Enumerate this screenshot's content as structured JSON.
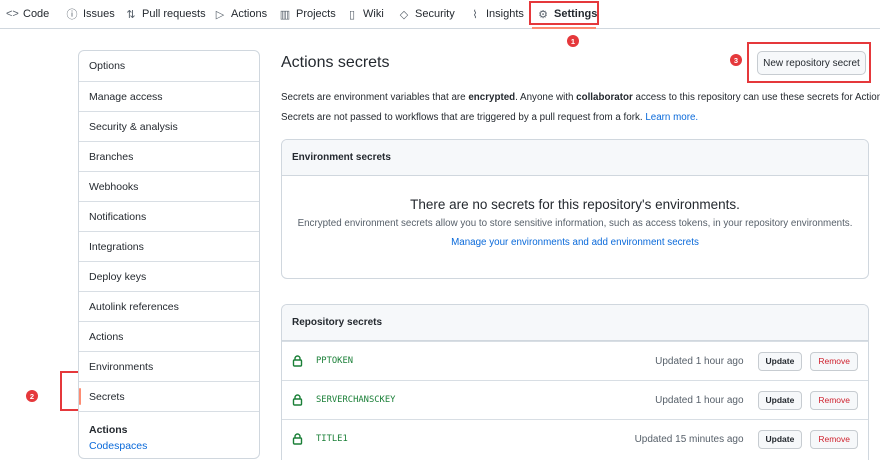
{
  "nav": {
    "tabs": [
      {
        "label": "Code",
        "icon": "code-icon",
        "glyph": "<>"
      },
      {
        "label": "Issues",
        "icon": "issue-icon",
        "glyph": "ⓘ"
      },
      {
        "label": "Pull requests",
        "icon": "pull-request-icon",
        "glyph": "⇅"
      },
      {
        "label": "Actions",
        "icon": "play-icon",
        "glyph": "▷"
      },
      {
        "label": "Projects",
        "icon": "project-icon",
        "glyph": "▥"
      },
      {
        "label": "Wiki",
        "icon": "book-icon",
        "glyph": "▯"
      },
      {
        "label": "Security",
        "icon": "shield-icon",
        "glyph": "◇"
      },
      {
        "label": "Insights",
        "icon": "graph-icon",
        "glyph": "⌇"
      },
      {
        "label": "Settings",
        "icon": "gear-icon",
        "glyph": "⚙"
      }
    ],
    "active": "Settings"
  },
  "annotations": {
    "m1": "1",
    "m2": "2",
    "m3": "3",
    "color": "#e5383b"
  },
  "sidebar": {
    "items": [
      {
        "label": "Options"
      },
      {
        "label": "Manage access"
      },
      {
        "label": "Security & analysis"
      },
      {
        "label": "Branches"
      },
      {
        "label": "Webhooks"
      },
      {
        "label": "Notifications"
      },
      {
        "label": "Integrations"
      },
      {
        "label": "Deploy keys"
      },
      {
        "label": "Autolink references"
      },
      {
        "label": "Actions"
      },
      {
        "label": "Environments"
      },
      {
        "label": "Secrets"
      }
    ],
    "selected": "Secrets",
    "footer_heading": "Actions",
    "footer_link": "Codespaces"
  },
  "main": {
    "title": "Actions secrets",
    "new_button": "New repository secret",
    "desc1_a": "Secrets are environment variables that are ",
    "desc1_b": "encrypted",
    "desc1_c": ". Anyone with ",
    "desc1_d": "collaborator",
    "desc1_e": " access to this repository can use these secrets for Actions.",
    "desc2": "Secrets are not passed to workflows that are triggered by a pull request from a fork.",
    "learn_more": "Learn more."
  },
  "environment_secrets": {
    "heading": "Environment secrets",
    "blank_title": "There are no secrets for this repository's environments.",
    "blank_text": "Encrypted environment secrets allow you to store sensitive information, such as access tokens, in your repository environments.",
    "manage_link": "Manage your environments and add environment secrets"
  },
  "repository_secrets": {
    "heading": "Repository secrets",
    "rows": [
      {
        "name": "PPTOKEN",
        "updated": "Updated 1 hour ago"
      },
      {
        "name": "SERVERCHANSCKEY",
        "updated": "Updated 1 hour ago"
      },
      {
        "name": "TITLE1",
        "updated": "Updated 15 minutes ago"
      }
    ],
    "update_label": "Update",
    "remove_label": "Remove"
  },
  "colors": {
    "accent": "#fd8c73",
    "link": "#0969da",
    "secret_green": "#1a7f37",
    "danger": "#cf222e"
  }
}
